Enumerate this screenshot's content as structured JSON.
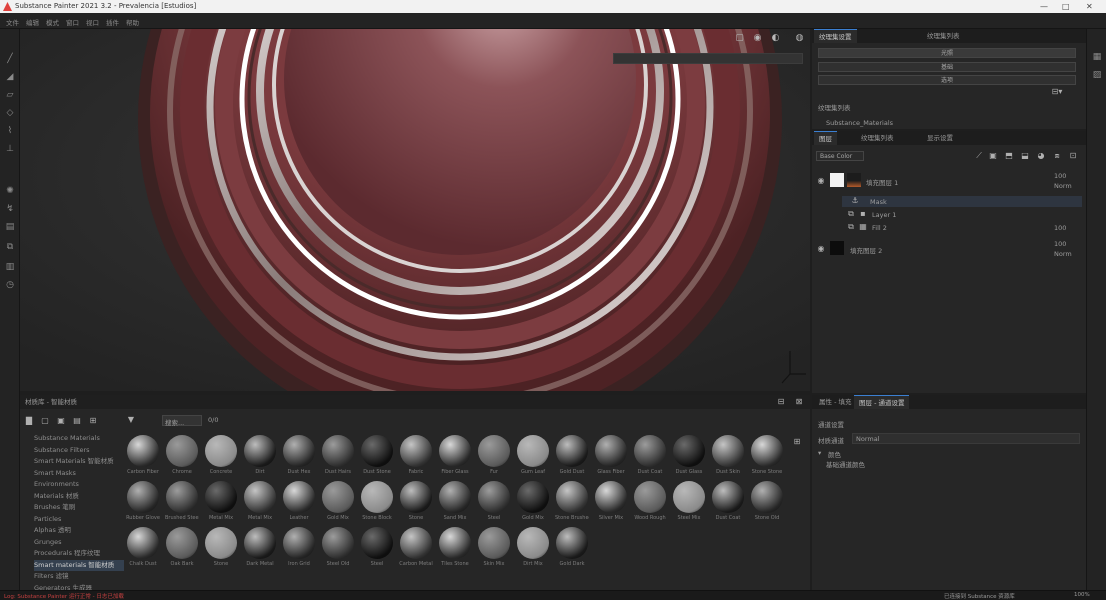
{
  "app": {
    "title": "Substance Painter 2021 3.2 - Prevalencia [Estudios]",
    "window_controls": [
      "—",
      "□",
      "✕"
    ]
  },
  "menu": [
    "文件",
    "编辑",
    "模式",
    "窗口",
    "视口",
    "插件",
    "帮助"
  ],
  "viewport": {
    "icons": [
      "frame-icon",
      "camera-icon",
      "light-icon",
      "render-icon"
    ]
  },
  "texture_set": {
    "tabs": [
      "纹理集设置",
      "纹理集列表"
    ],
    "header_button": "光照",
    "rows": [
      "基础",
      "选项"
    ],
    "list_label": "纹理集列表",
    "item": "Substance_Materials"
  },
  "layers": {
    "tabs": [
      "图层",
      "纹理集列表",
      "显示设置"
    ],
    "dropdown": "Base Color",
    "items": [
      {
        "name": "填充图层 1",
        "opacity": "100",
        "blend": "Norm"
      },
      {
        "name": "Mask",
        "opacity": ""
      },
      {
        "name": "Layer 1"
      },
      {
        "name": "Fill 2",
        "opacity": "100"
      },
      {
        "name": "填充图层 2",
        "opacity": "100",
        "blend": "Norm"
      }
    ]
  },
  "shelf": {
    "title": "材质库 - 智能材质",
    "search_placeholder": "搜索...",
    "tree": [
      "Substance Materials",
      "Substance Filters",
      "Smart Materials 智能材质",
      "Smart Masks",
      "Environments",
      "Materials 材质",
      "Brushes 笔刷",
      "Particles",
      "Alphas 透明",
      "Grunges",
      "Procedurals 程序纹理",
      "Smart materials 智能材质",
      "Filters 滤镜",
      "Generators 生成器"
    ],
    "selected_tree_item": 11,
    "materials": [
      {
        "name": "Carbon Fiber"
      },
      {
        "name": "Chrome"
      },
      {
        "name": "Concrete"
      },
      {
        "name": "Dirt"
      },
      {
        "name": "Dust Hex"
      },
      {
        "name": "Dust Hairs"
      },
      {
        "name": "Dust Stone"
      },
      {
        "name": "Fabric"
      },
      {
        "name": "Fiber Glass"
      },
      {
        "name": "Fur"
      },
      {
        "name": "Gum Leaf"
      },
      {
        "name": "Gold Dust"
      },
      {
        "name": "Glass Fiber"
      },
      {
        "name": "Dust Coat"
      },
      {
        "name": "Dust Glass"
      },
      {
        "name": "Dust Skin"
      },
      {
        "name": "Stone Stone"
      },
      {
        "name": "Rubber Glove"
      },
      {
        "name": "Brushed Steel"
      },
      {
        "name": "Metal Mix"
      },
      {
        "name": "Metal Mix"
      },
      {
        "name": "Leather"
      },
      {
        "name": "Gold Mix"
      },
      {
        "name": "Stone Block"
      },
      {
        "name": "Stone"
      },
      {
        "name": "Sand Mix"
      },
      {
        "name": "Steel"
      },
      {
        "name": "Gold Mix"
      },
      {
        "name": "Stone Brushed"
      },
      {
        "name": "Silver Mix"
      },
      {
        "name": "Wood Rough"
      },
      {
        "name": "Steel Mix"
      },
      {
        "name": "Dust Coat"
      },
      {
        "name": "Stone Old"
      },
      {
        "name": "Chalk Dust"
      },
      {
        "name": "Oak Bark"
      },
      {
        "name": "Stone"
      },
      {
        "name": "Dark Metal"
      },
      {
        "name": "Iron Grid"
      },
      {
        "name": "Steel Old"
      },
      {
        "name": "Steel"
      },
      {
        "name": "Carbon Metal"
      },
      {
        "name": "Tiles Stone"
      },
      {
        "name": "Skin Mix"
      },
      {
        "name": "Dirt Mix"
      },
      {
        "name": "Gold Dark"
      }
    ]
  },
  "properties": {
    "tabs": [
      "属性 - 填充",
      "图层 - 通道设置"
    ],
    "heading": "通道设置",
    "field_label": "材质通道",
    "field_value": "Normal",
    "section": "颜色",
    "section_sub": "基础通道颜色"
  },
  "status": {
    "left": "Log: Substance Painter 运行正常 - 日志已加载",
    "right": "已连接到 Substance 资源库",
    "right2": "100%"
  }
}
